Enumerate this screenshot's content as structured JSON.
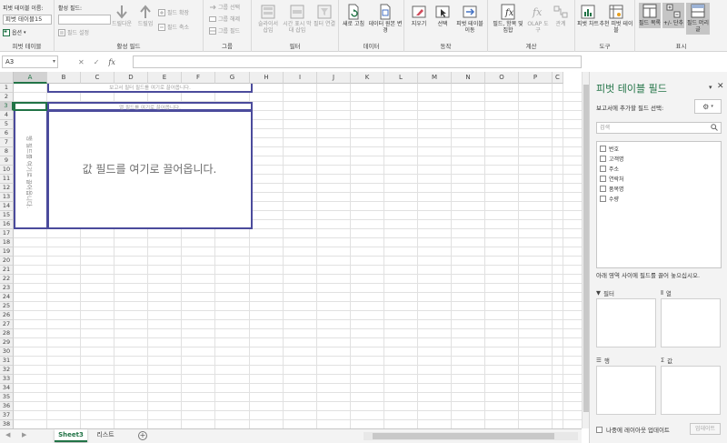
{
  "ribbon": {
    "pivot_table_group": {
      "name_label": "피벗 테이블 이름:",
      "name_value": "피벗 테이블15",
      "options_label": "옵션",
      "group_label": "피벗 테이블"
    },
    "active_field_group": {
      "label": "활성 필드:",
      "value": "",
      "field_settings": "필드 설정",
      "drill_down": "드릴다운",
      "drill_up": "드릴업",
      "expand": "필드 확장",
      "collapse": "필드 축소",
      "group_label": "활성 필드"
    },
    "group_group": {
      "select": "그룹 선택",
      "ungroup": "그룹 해제",
      "group_field": "그룹 필드",
      "group_label": "그룹"
    },
    "filter_group": {
      "slicer": "슬라이서 삽입",
      "timeline": "시간 표시 막대 삽입",
      "connections": "필터 연결",
      "group_label": "필터"
    },
    "data_group": {
      "refresh": "새로 고침",
      "change_source": "데이터 원본 변경",
      "group_label": "데이터"
    },
    "actions_group": {
      "clear": "지우기",
      "select": "선택",
      "move": "피벗 테이블 이동",
      "group_label": "동작"
    },
    "calc_group": {
      "fields_items": "필드, 항목 및 집합",
      "olap": "OLAP 도구",
      "relationships": "관계",
      "group_label": "계산"
    },
    "tools_group": {
      "pivot_chart": "피벗 차트",
      "recommended": "추천 피벗 테이블",
      "group_label": "도구"
    },
    "show_group": {
      "field_list": "필드 목록",
      "buttons": "+/- 단추",
      "headers": "필드 머리글",
      "group_label": "표시"
    }
  },
  "formula_bar": {
    "name_box": "A3",
    "fx": "fx",
    "formula": ""
  },
  "grid": {
    "columns": [
      "A",
      "B",
      "C",
      "D",
      "E",
      "F",
      "G",
      "H",
      "I",
      "J",
      "K",
      "L",
      "M",
      "N",
      "O",
      "P",
      "C"
    ],
    "rows": [
      "1",
      "2",
      "3",
      "4",
      "5",
      "6",
      "7",
      "8",
      "9",
      "10",
      "11",
      "12",
      "13",
      "14",
      "15",
      "16",
      "17",
      "18",
      "19",
      "20",
      "21",
      "22",
      "23",
      "24",
      "25",
      "26",
      "27",
      "28",
      "29",
      "30",
      "31",
      "32",
      "33",
      "34",
      "35",
      "36",
      "37",
      "38"
    ],
    "selected_column": "A",
    "selected_row": "3",
    "report_filter_hint": "보고서 필터 필드를 여기로 끌어옵니다.",
    "column_hint": "열 필드를 여기로 끌어옵니다.",
    "row_hint": "행 필드를 여기로 끌어옵니다.",
    "values_hint": "값 필드를 여기로 끌어옵니다."
  },
  "sheet_tabs": {
    "tabs": [
      "Sheet3",
      "리스트"
    ],
    "active": "Sheet3",
    "add_label": "+"
  },
  "field_pane": {
    "title": "피벗 테이블 필드",
    "subtitle": "보고서에 추가할 필드 선택:",
    "search_placeholder": "검색",
    "fields": [
      "번호",
      "고객명",
      "주소",
      "연락처",
      "품목명",
      "수량"
    ],
    "drag_hint": "아래 영역 사이에 필드를 끌어 놓으십시오.",
    "areas": {
      "filter": "필터",
      "columns": "열",
      "rows": "행",
      "values": "값"
    },
    "defer_label": "나중에 레이아웃 업데이트",
    "update_button": "업데이트"
  },
  "colors": {
    "accent_green": "#217346",
    "pivot_border": "#4b4b9c"
  }
}
